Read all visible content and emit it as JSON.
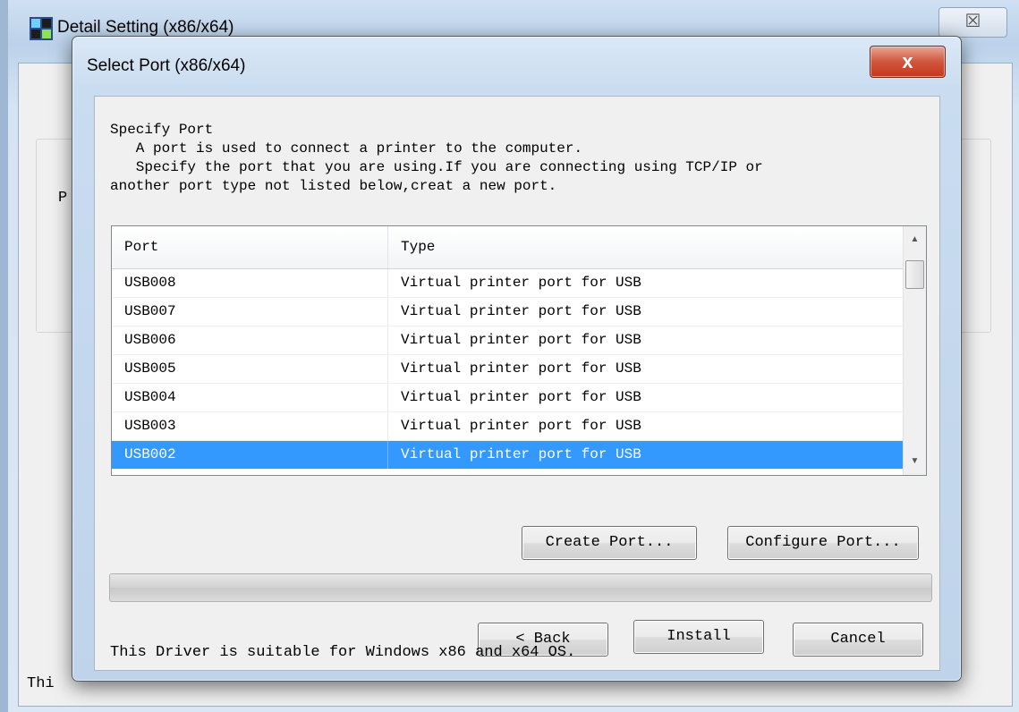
{
  "background_window": {
    "title": "Detail Setting (x86/x64)",
    "close_glyph": "☒",
    "group_label_fragment": "P",
    "footer_fragment": "Thi"
  },
  "dialog": {
    "title": "Select Port (x86/x64)",
    "close_glyph": "x",
    "description": {
      "heading": "Specify Port",
      "line1": "   A port is used to connect a printer to the computer.",
      "line2": "   Specify the port that you are using.If you are connecting using TCP/IP or",
      "line3": "another port type not listed below,creat a new port."
    },
    "list": {
      "columns": [
        "Port",
        "Type"
      ],
      "rows": [
        {
          "port": "USB008",
          "type": "Virtual printer port for USB"
        },
        {
          "port": "USB007",
          "type": "Virtual printer port for USB"
        },
        {
          "port": "USB006",
          "type": "Virtual printer port for USB"
        },
        {
          "port": "USB005",
          "type": "Virtual printer port for USB"
        },
        {
          "port": "USB004",
          "type": "Virtual printer port for USB"
        },
        {
          "port": "USB003",
          "type": "Virtual printer port for USB"
        },
        {
          "port": "USB002",
          "type": "Virtual printer port for USB"
        }
      ],
      "selected_port": "USB002"
    },
    "buttons": {
      "create_port": "Create Port...",
      "configure_port": "Configure Port...",
      "back": "< Back",
      "install": "Install",
      "cancel": "Cancel"
    },
    "progress_fraction": 0,
    "footer": "This Driver is suitable for Windows x86 and x64 OS."
  },
  "colors": {
    "selection": "#3399ff",
    "close_button": "#c4381e",
    "dialog_frame": "#c9dcf0"
  }
}
